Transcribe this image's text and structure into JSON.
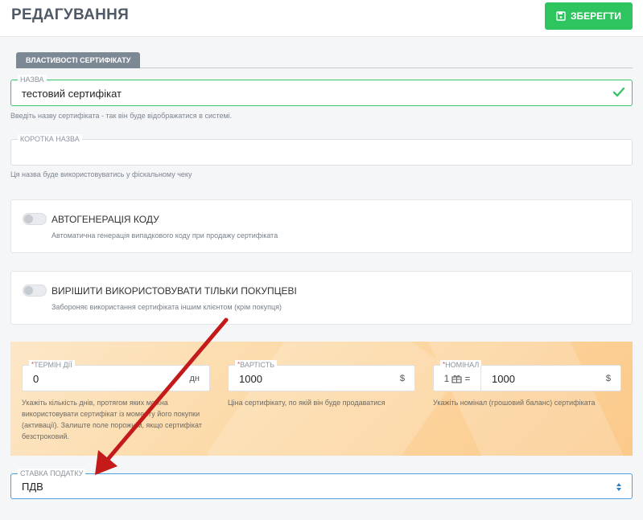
{
  "header": {
    "title": "РЕДАГУВАННЯ",
    "save_label": "ЗБЕРЕГТИ"
  },
  "tab": {
    "label": "ВЛАСТИВОСТІ СЕРТИФІКАТУ"
  },
  "name_field": {
    "label": "НАЗВА",
    "value": "тестовий сертифікат",
    "help": "Введіть назву сертифіката - так він буде відображатися в системі."
  },
  "short_name_field": {
    "label": "КОРОТКА НАЗВА",
    "value": "",
    "help": "Ця назва буде використовуватись у фіскальному чеку"
  },
  "autogen": {
    "title": "АВТОГЕНЕРАЦІЯ КОДУ",
    "desc": "Автоматична генерація випадкового коду при продажу сертифіката",
    "enabled": false
  },
  "buyer_only": {
    "title": "ВИРІШИТИ ВИКОРИСТОВУВАТИ ТІЛЬКИ ПОКУПЦЕВІ",
    "desc": "Забороняє використання сертифіката іншим клієнтом (крім покупця)",
    "enabled": false
  },
  "term": {
    "label": "ТЕРМІН ДІЇ",
    "value": "0",
    "suffix": "дн",
    "help": "Укажіть кількість днів, протягом яких можна використовувати сертифікат із моменту його покупки (активації). Залиште поле порожнім, якщо сертифікат безстроковий."
  },
  "price": {
    "label": "ВАРТІСТЬ",
    "value": "1000",
    "suffix": "$",
    "help": "Ціна сертифікату, по якій він буде продаватися"
  },
  "nominal": {
    "label": "НОМІНАЛ",
    "prefix_count": "1",
    "equals": "=",
    "value": "1000",
    "suffix": "$",
    "help": "Укажіть номінал (грошовий баланс) сертифіката"
  },
  "tax": {
    "label": "СТАВКА ПОДАТКУ",
    "value": "ПДВ"
  },
  "colors": {
    "accent_green": "#2ec45f",
    "arrow_red": "#c41a1a",
    "select_border": "#4aa3d8"
  }
}
